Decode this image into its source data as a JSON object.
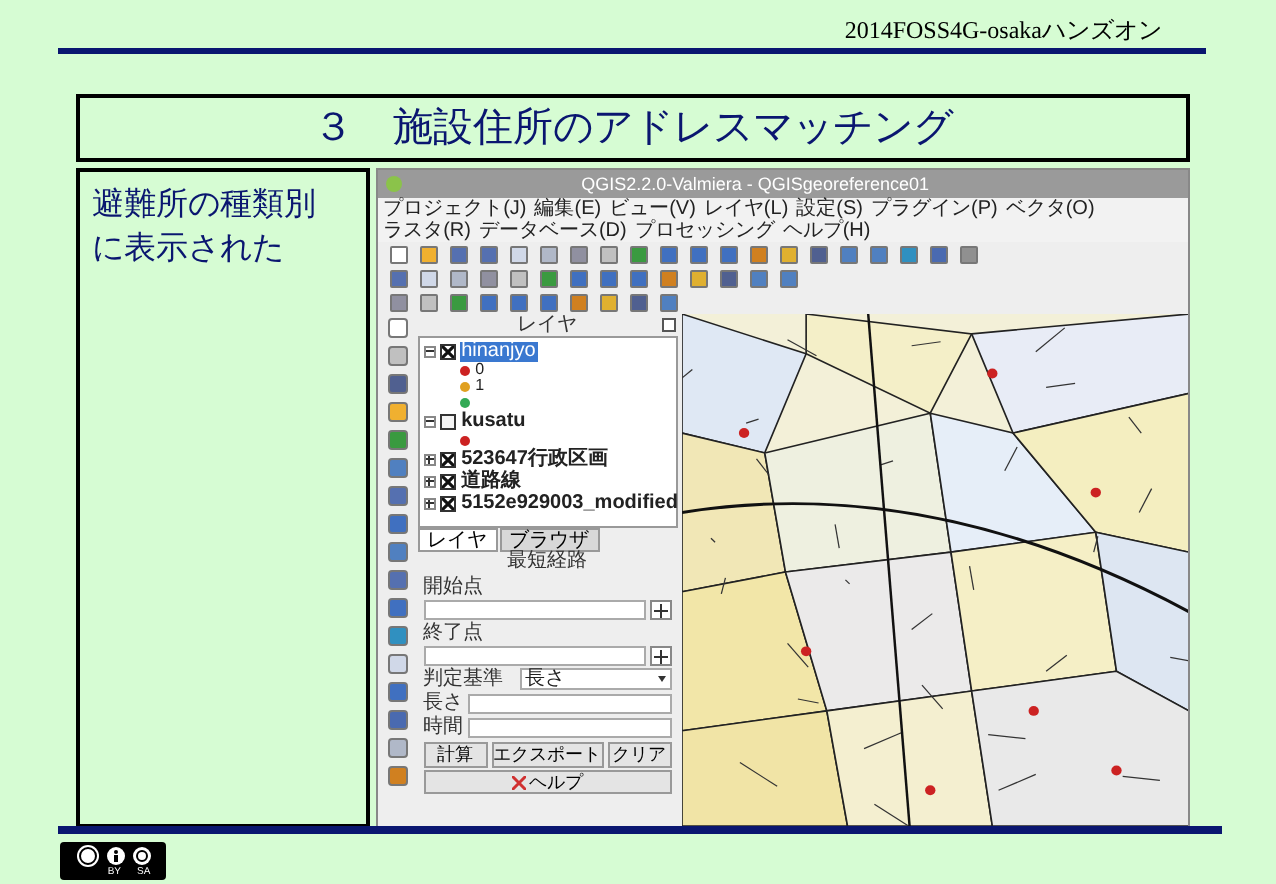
{
  "header": {
    "text": "2014FOSS4G-osakaハンズオン"
  },
  "slide_title": "３　施設住所のアドレスマッチング",
  "caption": "避難所の種類別に表示された",
  "qgis": {
    "title": "QGIS2.2.0-Valmiera - QGISgeoreference01",
    "menu": [
      "プロジェクト(J)",
      "編集(E)",
      "ビュー(V)",
      "レイヤ(L)",
      "設定(S)",
      "プラグイン(P)",
      "ベクタ(O)",
      "ラスタ(R)",
      "データベース(D)",
      "プロセッシング",
      "ヘルプ(H)"
    ],
    "layer_panel": {
      "title": "レイヤ",
      "layers": [
        {
          "label": "hinanjyo",
          "checked": true,
          "expanded": true,
          "selected": true,
          "children": [
            {
              "label": "0",
              "color": "#cc2222"
            },
            {
              "label": "1",
              "color": "#e0a020"
            },
            {
              "color": "#33aa55"
            }
          ]
        },
        {
          "label": "kusatu",
          "checked": false,
          "expanded": true,
          "selected": false,
          "children": [
            {
              "color": "#cc2222"
            }
          ]
        },
        {
          "label": "523647行政区画",
          "checked": true,
          "expanded": false,
          "selected": false
        },
        {
          "label": "道路線",
          "checked": true,
          "expanded": false,
          "selected": false
        },
        {
          "label": "5152e929003_modified",
          "checked": true,
          "expanded": false,
          "selected": false
        }
      ],
      "tabs": [
        {
          "label": "レイヤ",
          "selected": true
        },
        {
          "label": "ブラウザ",
          "selected": false
        }
      ]
    },
    "route_panel": {
      "title": "最短経路",
      "start_label": "開始点",
      "end_label": "終了点",
      "criterion_label": "判定基準",
      "criterion_value": "長さ",
      "length_label": "長さ",
      "time_label": "時間",
      "buttons": [
        "計算",
        "エクスポート",
        "クリア"
      ],
      "help_button": "ヘルプ"
    }
  },
  "license": {
    "labels": [
      "BY",
      "SA"
    ]
  }
}
